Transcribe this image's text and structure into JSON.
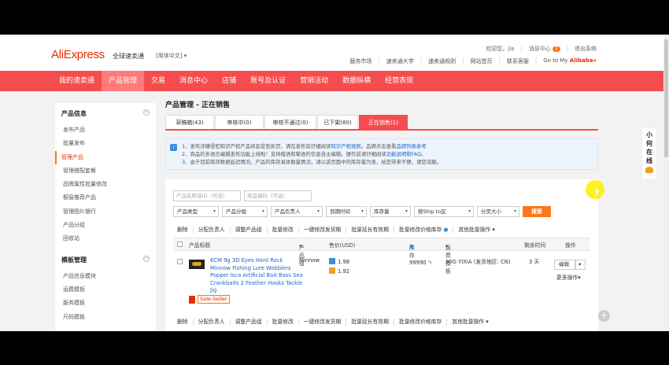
{
  "header": {
    "logo": "AliExpress",
    "logo_sub": "全球速卖通",
    "lang": "[简体中文]",
    "welcome": "欢迎您，jia",
    "messages": "消息中心",
    "messages_count": "7",
    "logout": "退出系统",
    "links": [
      "服务市场",
      "速卖通大学",
      "速卖通规则",
      "网站首页",
      "联系客服"
    ],
    "goto_prefix": "Go to My ",
    "goto_brand": "Alibaba",
    "goto_suffix": "»"
  },
  "nav": [
    "我的速卖通",
    "产品管理",
    "交易",
    "消息中心",
    "店铺",
    "账号及认证",
    "营销活动",
    "数据纵横",
    "经营表现"
  ],
  "sidebar": {
    "section1_title": "产品信息",
    "section1_items": [
      "发布产品",
      "批量发布",
      "管理产品",
      "管理搭配套餐",
      "品牌属性批量修改",
      "橱窗推荐产品",
      "管理图片银行",
      "产品分组",
      "回收站"
    ],
    "section2_title": "模板管理",
    "section2_items": [
      "产品信息模块",
      "运费模板",
      "服务模板",
      "尺码模板"
    ]
  },
  "main": {
    "page_title": "产品管理 - 正在销售",
    "tabs": [
      "草稿箱(43)",
      "审核中(0)",
      "审核不通过(0)",
      "已下架(80)",
      "正在销售(1)"
    ],
    "notice_line1_a": "1、发布涉嫌侵犯知识产权产品将会受到处罚，请在发布前仔细阅读",
    "notice_line1_link1": "知识产权规则",
    "notice_line1_b": "。品牌点击查看",
    "notice_line1_link2": "品牌列表参考",
    "notice_line2_a": "2、商品的多语言编辑发布功能上线啦！支持俄语和葡语的信息自主编辑。操作前请仔细阅读",
    "notice_line2_link": "功能说明和FAQ",
    "notice_line2_b": "。",
    "notice_line3": "3、由于目前库存数据延迟情况，产品的库存具体数量情况，请以该页面中的库存量为准，给您带来不便，请您谅解。",
    "filters": {
      "name_placeholder": "产品名称或ID（可选）",
      "code_placeholder": "商品编码（可选）",
      "selects": [
        "产品类型",
        "产品分组",
        "产品负责人",
        "到期时间",
        "库存量",
        "按Ship to区",
        "分页大小"
      ],
      "search": "搜索"
    },
    "actions": [
      "删除",
      "分配负责人",
      "调整产品组",
      "批量修改",
      "一键修改发货期",
      "批量延长有效期",
      "批量修改价格库存",
      "其他批量操作"
    ],
    "table_headers": [
      "产品标题",
      "产品组",
      "售价(USD)",
      "库存",
      "运费模板",
      "剩余时间",
      "操作"
    ],
    "row": {
      "title": "6CM 9g 3D Eyes Hard Rock Minnow Fishing Lure Wobblers Popper Isca Artificial Bait Bass Sea Crankbaits 2 Feather Hooks Tackle Jig",
      "group": "Minnow",
      "price1": "1.98",
      "price2": "1.92",
      "stock": "99990",
      "shipping": "30G YIXIA (发货地区: CN)",
      "remaining": "3 天",
      "edit": "编辑",
      "more": "更多操作",
      "tag": "Sale-Seller"
    }
  },
  "widget": [
    "小",
    "何",
    "在",
    "线"
  ],
  "colors": {
    "brand_red": "#f54d4d",
    "accent_orange": "#ff7519",
    "link_blue": "#1a66c8"
  }
}
